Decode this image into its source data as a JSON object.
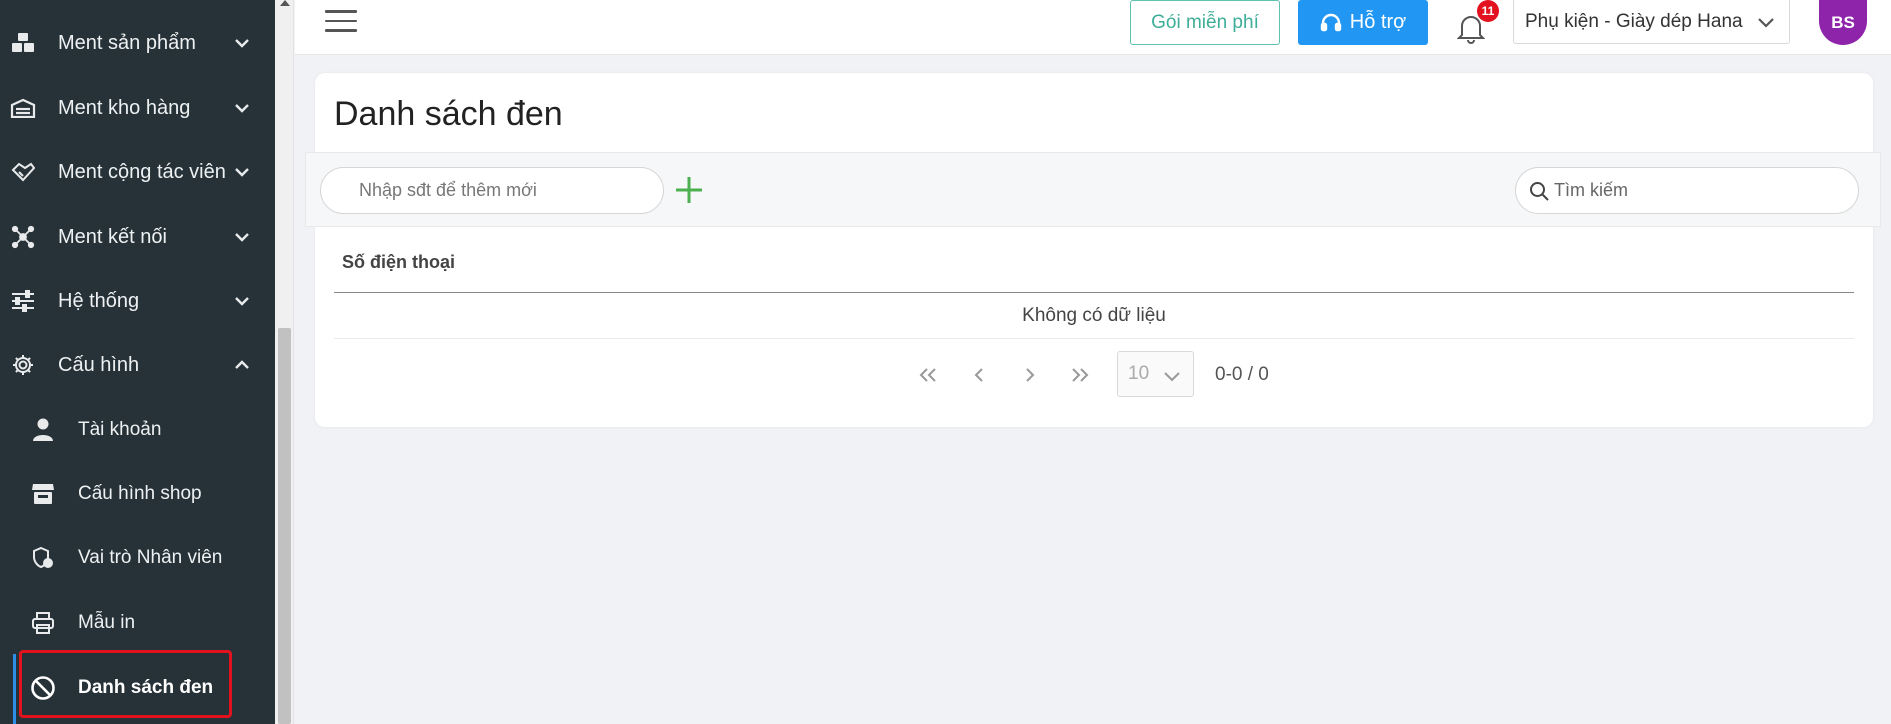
{
  "sidebar": {
    "items": [
      {
        "label": "Ment sản phẩm",
        "icon": "cubes-icon",
        "expanded": false
      },
      {
        "label": "Ment kho hàng",
        "icon": "warehouse-icon",
        "expanded": false
      },
      {
        "label": "Ment cộng tác viên",
        "icon": "handshake-icon",
        "expanded": false
      },
      {
        "label": "Ment kết nối",
        "icon": "network-icon",
        "expanded": false
      },
      {
        "label": "Hệ thống",
        "icon": "sliders-icon",
        "expanded": false
      },
      {
        "label": "Cấu hình",
        "icon": "gear-icon",
        "expanded": true
      }
    ],
    "sub_items": [
      {
        "label": "Tài khoản",
        "icon": "user-icon"
      },
      {
        "label": "Cấu hình shop",
        "icon": "store-icon"
      },
      {
        "label": "Vai trò Nhân viên",
        "icon": "user-shield-icon"
      },
      {
        "label": "Mẫu in",
        "icon": "printer-icon"
      },
      {
        "label": "Danh sách đen",
        "icon": "ban-icon",
        "active": true
      }
    ]
  },
  "header": {
    "free_plan_label": "Gói miễn phí",
    "support_label": "Hỗ trợ",
    "notification_count": "11",
    "shop_name": "Phụ kiện - Giày dép Hana",
    "avatar_initials": "BS"
  },
  "main": {
    "title": "Danh sách đen",
    "add_input_placeholder": "Nhập sđt để thêm mới",
    "search_placeholder": "Tìm kiếm",
    "table": {
      "columns": [
        "Số điện thoại"
      ],
      "rows": [],
      "empty_text": "Không có dữ liệu"
    },
    "pagination": {
      "page_size": "10",
      "range_text": "0-0 / 0"
    }
  },
  "colors": {
    "sidebar_bg": "#263238",
    "primary": "#2196f3",
    "free_plan": "#3fae98",
    "avatar_bg": "#8e24aa",
    "add_icon": "#4caf50",
    "highlight": "#e2131e"
  }
}
